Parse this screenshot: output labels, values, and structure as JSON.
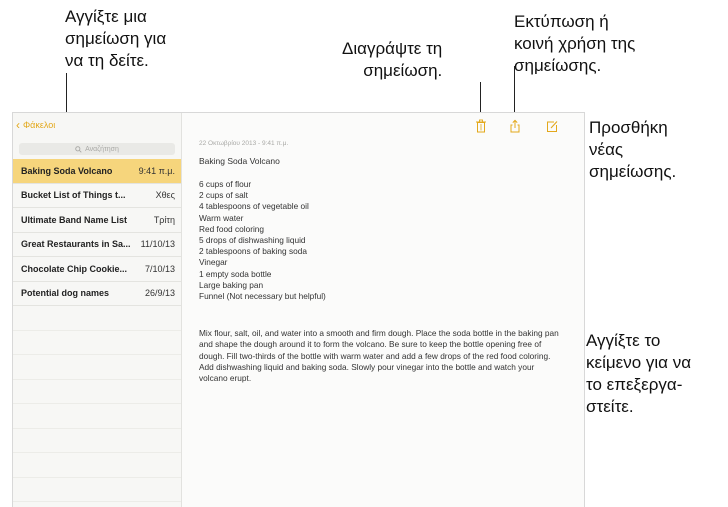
{
  "callouts": {
    "view_note": "Αγγίξτε μια\nσημείωση για\nνα τη δείτε.",
    "delete_note": "Διαγράψτε τη\nσημείωση.",
    "print_share": "Εκτύπωση ή\nκοινή χρήση της\nσημείωσης.",
    "new_note": "Προσθήκη\nνέας\nσημείωσης.",
    "edit_text": "Αγγίξτε το\nκείμενο για να\nτο επεξεργα-\nστείτε."
  },
  "sidebar": {
    "back_label": "Φάκελοι",
    "search_placeholder": "Αναζήτηση",
    "notes": [
      {
        "title": "Baking Soda Volcano",
        "date": "9:41 π.μ.",
        "selected": true
      },
      {
        "title": "Bucket List of Things t...",
        "date": "Χθες"
      },
      {
        "title": "Ultimate Band Name List",
        "date": "Τρίτη"
      },
      {
        "title": "Great Restaurants in Sa...",
        "date": "11/10/13"
      },
      {
        "title": "Chocolate Chip Cookie...",
        "date": "7/10/13"
      },
      {
        "title": "Potential dog names",
        "date": "26/9/13"
      }
    ]
  },
  "note": {
    "timestamp": "22 Οκτωβρίου 2013 - 9:41 π.μ.",
    "title": "Baking Soda Volcano",
    "ingredients": [
      "6 cups of flour",
      "2 cups of salt",
      "4 tablespoons of vegetable oil",
      "Warm water",
      "Red food coloring",
      "5 drops of dishwashing liquid",
      "2 tablespoons of baking soda",
      "Vinegar",
      "1 empty soda bottle",
      "Large baking pan",
      "Funnel (Not necessary but helpful)"
    ],
    "paragraph": "Mix flour, salt, oil, and water into a smooth and firm dough.  Place the soda bottle in the baking pan and shape the dough around it to form the volcano.  Be sure to keep the bottle opening free of dough.  Fill two-thirds of the bottle with warm water and add a few drops of the red food coloring. Add dishwashing liquid and baking soda. Slowly pour vinegar into the bottle and watch your volcano erupt."
  },
  "colors": {
    "accent": "#e3a81b",
    "selected_row": "#f6d57c"
  },
  "icons": {
    "back": "chevron-left-icon",
    "search": "search-icon",
    "delete": "trash-icon",
    "share": "share-icon",
    "compose": "compose-icon"
  }
}
